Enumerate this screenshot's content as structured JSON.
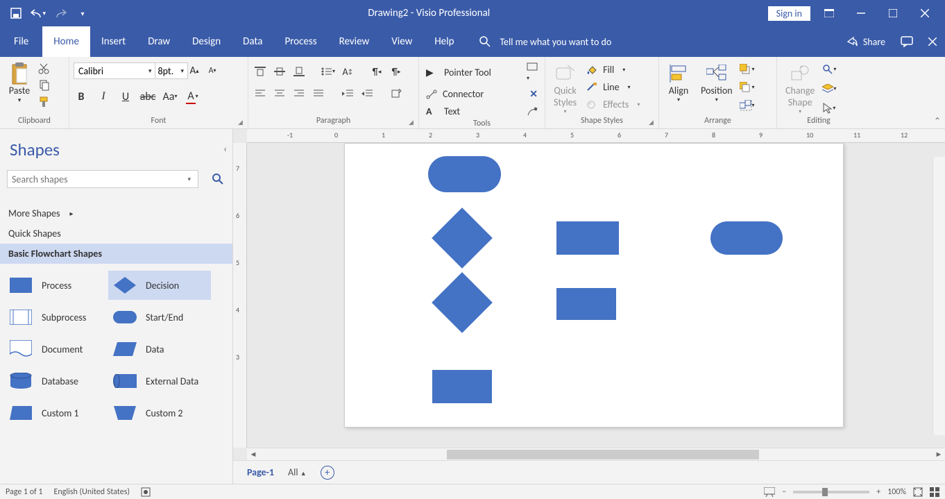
{
  "title": {
    "doc": "Drawing2",
    "sep": "  -  ",
    "app": "Visio Professional"
  },
  "signin": "Sign in",
  "tabs": {
    "file": "File",
    "home": "Home",
    "insert": "Insert",
    "draw": "Draw",
    "design": "Design",
    "data": "Data",
    "process": "Process",
    "review": "Review",
    "view": "View",
    "help": "Help"
  },
  "tellme": "Tell me what you want to do",
  "share": "Share",
  "ribbon": {
    "clipboard": {
      "paste": "Paste",
      "label": "Clipboard"
    },
    "font": {
      "name": "Calibri",
      "size": "8pt.",
      "label": "Font"
    },
    "paragraph": {
      "label": "Paragraph"
    },
    "tools": {
      "pointer": "Pointer Tool",
      "connector": "Connector",
      "text": "Text",
      "label": "Tools"
    },
    "styles": {
      "quick": "Quick",
      "styles": "Styles",
      "fill": "Fill",
      "line": "Line",
      "effects": "Effects",
      "label": "Shape Styles"
    },
    "arrange": {
      "align": "Align",
      "position": "Position",
      "label": "Arrange"
    },
    "editing": {
      "change": "Change",
      "shape": "Shape",
      "label": "Editing"
    }
  },
  "shapes": {
    "title": "Shapes",
    "search_ph": "Search shapes",
    "more": "More Shapes",
    "quick": "Quick Shapes",
    "basic": "Basic Flowchart Shapes",
    "items": {
      "process": "Process",
      "decision": "Decision",
      "subprocess": "Subprocess",
      "startend": "Start/End",
      "document": "Document",
      "data": "Data",
      "database": "Database",
      "external": "External Data",
      "custom1": "Custom 1",
      "custom2": "Custom 2"
    }
  },
  "ruler_h": [
    "-1",
    "0",
    "1",
    "2",
    "3",
    "4",
    "5",
    "6",
    "7",
    "8",
    "9",
    "10",
    "11",
    "12"
  ],
  "ruler_v": [
    "7",
    "6",
    "5",
    "4",
    "3"
  ],
  "pagetabs": {
    "p1": "Page-1",
    "all": "All"
  },
  "status": {
    "page": "Page 1 of 1",
    "lang": "English (United States)",
    "zoom": "100%"
  }
}
